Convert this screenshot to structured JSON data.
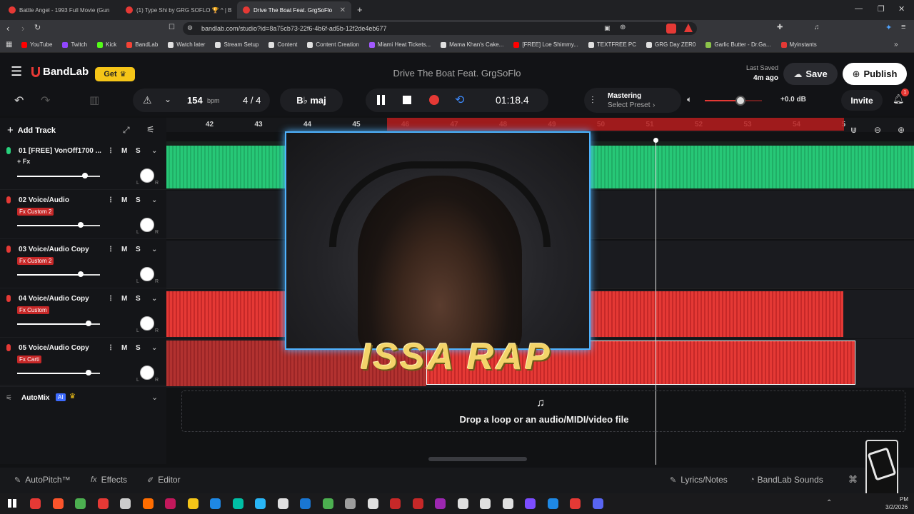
{
  "browser": {
    "tabs": [
      {
        "title": "Battle Angel - 1993 Full Movie (Gun"
      },
      {
        "title": "(1) Type Shi by GRG SOFLO 🏆 ^ | B"
      },
      {
        "title": "Drive The Boat Feat. GrgSoFlo"
      }
    ],
    "url": "bandlab.com/studio?id=8a75cb73-22f6-4b6f-ad5b-12f2de4eb677",
    "bookmarks": [
      "YouTube",
      "Twitch",
      "Kick",
      "BandLab",
      "Watch later",
      "Stream Setup",
      "Content",
      "Content Creation",
      "Miami Heat Tickets...",
      "Mama Khan's Cake...",
      "[FREE] Loe Shimmy...",
      "TEXTFREE PC",
      "GRG Day ZER0",
      "Garlic Butter - Dr.Ga...",
      "Myinstants"
    ],
    "colors": {
      "bookmark_icons": [
        "#ff0000",
        "#9146ff",
        "#53fc18",
        "#f44336",
        "#e0e0e0",
        "#e0e0e0",
        "#e0e0e0",
        "#e0e0e0",
        "#a259ff",
        "#e0e0e0",
        "#ff0000",
        "#e0e0e0",
        "#e0e0e0",
        "#8bc34a",
        "#e53935"
      ]
    }
  },
  "app": {
    "logo": "BandLab",
    "get_label": "Get",
    "project_title": "Drive The Boat Feat. GrgSoFlo",
    "last_saved_label": "Last Saved",
    "last_saved_time": "4m ago",
    "save_label": "Save",
    "publish_label": "Publish",
    "accent": "#f5c518"
  },
  "toolbar": {
    "bpm_value": "154",
    "bpm_unit": "bpm",
    "time_sig": "4 / 4",
    "key": "B♭ maj",
    "time": "01:18.4",
    "mastering_label": "Mastering",
    "preset_label": "Select Preset",
    "volume_db": "+0.0 dB",
    "volume_level": 0.63,
    "invite_label": "Invite",
    "notif_count": "1",
    "add_track_label": "Add Track"
  },
  "ruler": [
    "42",
    "43",
    "44",
    "45",
    "46",
    "47",
    "48",
    "49",
    "50",
    "51",
    "52",
    "53",
    "54",
    "5"
  ],
  "tracks": [
    {
      "name": "01  [FREE] VonOff1700 ...",
      "fx": "+ Fx",
      "fx_style": "plain",
      "color": "#28d17c",
      "volume": 0.82,
      "m": "M",
      "s": "S"
    },
    {
      "name": "02  Voice/Audio",
      "fx": "Fx  Custom 2",
      "fx_style": "badge",
      "color": "#e53935",
      "volume": 0.77,
      "m": "M",
      "s": "S"
    },
    {
      "name": "03  Voice/Audio Copy",
      "fx": "Fx  Custom 2",
      "fx_style": "badge",
      "color": "#e53935",
      "volume": 0.77,
      "m": "M",
      "s": "S"
    },
    {
      "name": "04  Voice/Audio Copy",
      "fx": "Fx  Custom",
      "fx_style": "badge",
      "color": "#e53935",
      "volume": 0.86,
      "m": "M",
      "s": "S"
    },
    {
      "name": "05  Voice/Audio Copy",
      "fx": "Fx  Carti",
      "fx_style": "badge",
      "color": "#e53935",
      "volume": 0.86,
      "m": "M",
      "s": "S"
    }
  ],
  "pan_labels": {
    "l": "L",
    "r": "R"
  },
  "automix": {
    "label": "AutoMix",
    "ai": "AI"
  },
  "dropzone": {
    "text": "Drop a loop or an audio/MIDI/video file"
  },
  "overlay": {
    "text": "ISSA RAP"
  },
  "bottom": {
    "autopitch": "AutoPitch™",
    "effects": "Effects",
    "editor": "Editor",
    "lyrics": "Lyrics/Notes",
    "sounds": "BandLab Sounds"
  },
  "taskbar": {
    "time": "PM",
    "date": "3/2/2026"
  }
}
